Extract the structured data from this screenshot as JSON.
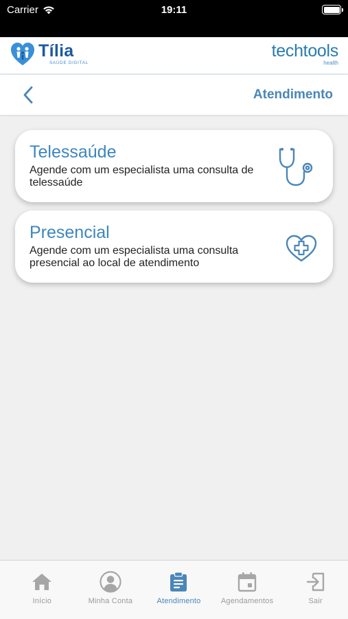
{
  "status_bar": {
    "carrier": "Carrier",
    "time": "19:11"
  },
  "brand": {
    "tilia_name": "Tília",
    "tilia_subtitle": "SAÚDE DIGITAL",
    "partner_name": "techtools",
    "partner_subtitle": "health"
  },
  "nav": {
    "title": "Atendimento",
    "back_icon": "chevron-left-icon"
  },
  "cards": [
    {
      "title": "Telessaúde",
      "description": "Agende com um especialista uma consulta de telessaúde",
      "icon": "stethoscope-icon"
    },
    {
      "title": "Presencial",
      "description": "Agende com um especialista uma consulta presencial ao local de atendimento",
      "icon": "heart-plus-icon"
    }
  ],
  "tabs": [
    {
      "label": "Início",
      "icon": "home-icon",
      "active": false
    },
    {
      "label": "Minha Conta",
      "icon": "account-icon",
      "active": false
    },
    {
      "label": "Atendimento",
      "icon": "clipboard-icon",
      "active": true
    },
    {
      "label": "Agendamentos",
      "icon": "calendar-icon",
      "active": false
    },
    {
      "label": "Sair",
      "icon": "exit-icon",
      "active": false
    }
  ],
  "colors": {
    "accent": "#4a86b8",
    "card_title": "#3d86bd",
    "inactive": "#9a9a9a",
    "background": "#f0f0f0"
  }
}
